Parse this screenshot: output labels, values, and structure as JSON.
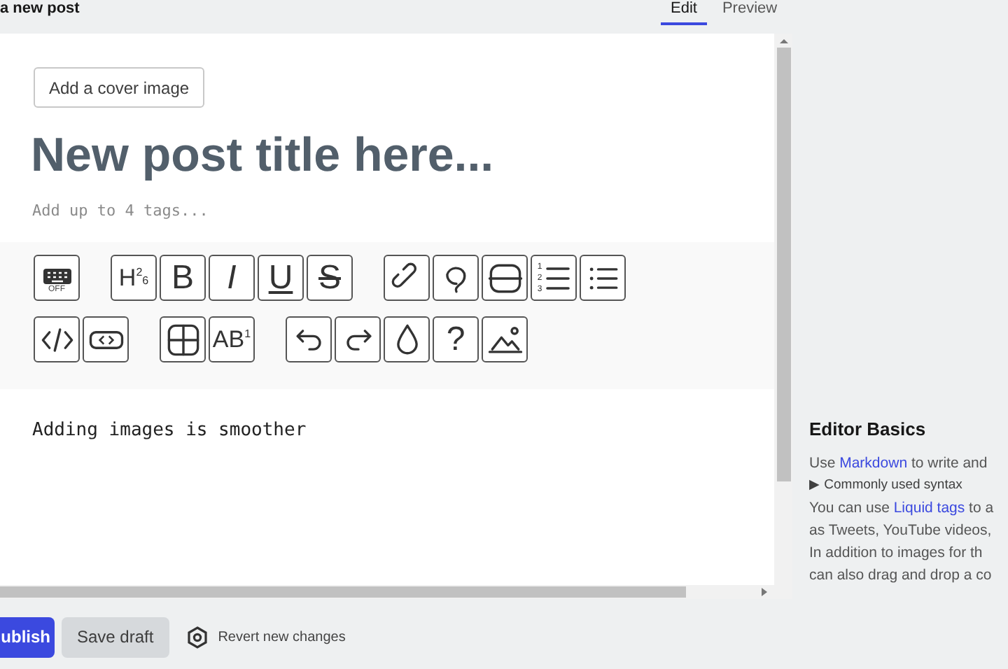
{
  "header": {
    "title": "a new post",
    "tabs": [
      {
        "label": "Edit",
        "selected": true
      },
      {
        "label": "Preview",
        "selected": false
      }
    ]
  },
  "editor": {
    "cover_button": "Add a cover image",
    "title_placeholder": "New post title here...",
    "tags_placeholder": "Add up to 4 tags...",
    "toolbar": [
      [
        [
          {
            "kind": "keyboard",
            "caption": "OFF"
          }
        ],
        [
          {
            "kind": "text",
            "text": "H$^{2}$$_{6}$"
          },
          {
            "kind": "text",
            "text": "B"
          },
          {
            "kind": "italic",
            "text": "I"
          },
          {
            "kind": "underline",
            "text": "U"
          },
          {
            "kind": "strike",
            "text": "S"
          }
        ],
        [
          {
            "kind": "link"
          },
          {
            "kind": "comment"
          },
          {
            "kind": "divider"
          },
          {
            "kind": "ordered-list",
            "numbers": [
              "1",
              "2",
              "3"
            ]
          },
          {
            "kind": "bullet-list"
          }
        ]
      ],
      [
        [
          {
            "kind": "code"
          },
          {
            "kind": "code-block"
          }
        ],
        [
          {
            "kind": "table"
          },
          {
            "kind": "text",
            "text": "AB$^{1}$"
          }
        ],
        [
          {
            "kind": "undo"
          },
          {
            "kind": "redo"
          },
          {
            "kind": "drop"
          },
          {
            "kind": "text",
            "text": "?"
          },
          {
            "kind": "image"
          }
        ]
      ]
    ],
    "body": "Adding images is smoother"
  },
  "sidebar": {
    "title": "Editor Basics",
    "lines": [
      {
        "kind": "text",
        "parts": [
          {
            "text": "Use "
          },
          {
            "text": "Markdown",
            "link": true
          },
          {
            "text": " to write and"
          }
        ]
      },
      {
        "kind": "details",
        "parts": [
          {
            "text": "▶ Commonly used syntax"
          }
        ]
      },
      {
        "kind": "text",
        "parts": [
          {
            "text": "You can use "
          },
          {
            "text": "Liquid tags",
            "link": true
          },
          {
            "text": " to a"
          }
        ]
      },
      {
        "kind": "text",
        "parts": [
          {
            "text": "as Tweets, YouTube videos,"
          }
        ]
      },
      {
        "kind": "text",
        "parts": [
          {
            "text": "In addition to images for th"
          }
        ]
      },
      {
        "kind": "text",
        "parts": [
          {
            "text": "can also drag and drop a co"
          }
        ]
      }
    ]
  },
  "footer": {
    "publish": "ublish",
    "save_draft": "Save draft",
    "revert": "Revert new changes"
  }
}
